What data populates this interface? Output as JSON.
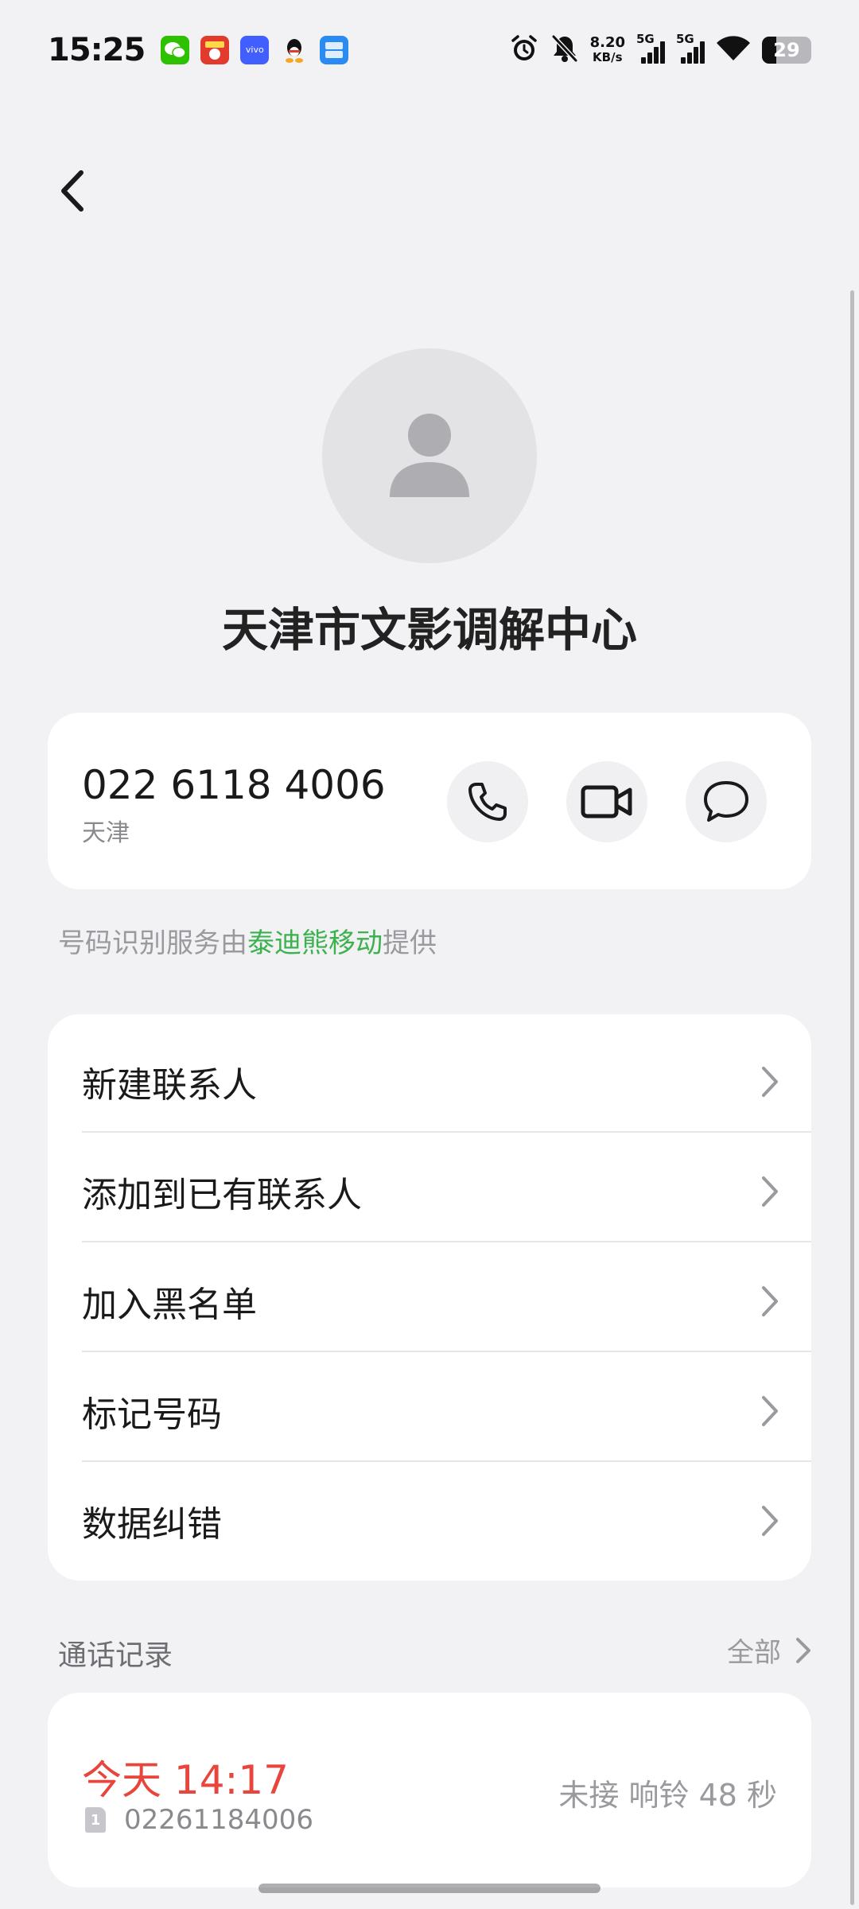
{
  "status_bar": {
    "time": "15:25",
    "apps": [
      {
        "name": "wechat-icon",
        "color": "#2dc100"
      },
      {
        "name": "shopping-app-icon",
        "color": "#e23b2e"
      },
      {
        "name": "vivo-icon",
        "color": "#415fff",
        "text": "vivo"
      },
      {
        "name": "qq-icon",
        "color": "#ffffff"
      },
      {
        "name": "xianyu-icon",
        "color": "#2a8cf3"
      }
    ],
    "net_speed_value": "8.20",
    "net_speed_unit": "KB/s",
    "network_1": "5G",
    "network_2": "5G",
    "battery": "29"
  },
  "contact": {
    "name": "天津市文影调解中心",
    "number": "022 6118 4006",
    "location": "天津"
  },
  "provider_note": {
    "prefix": "号码识别服务由",
    "provider": "泰迪熊移动",
    "suffix": "提供"
  },
  "actions": [
    {
      "label": "新建联系人"
    },
    {
      "label": "添加到已有联系人"
    },
    {
      "label": "加入黑名单"
    },
    {
      "label": "标记号码"
    },
    {
      "label": "数据纠错"
    }
  ],
  "call_log": {
    "title": "通话记录",
    "all_label": "全部",
    "entries": [
      {
        "time": "今天 14:17",
        "sim": "1",
        "number": "02261184006",
        "status": "未接 响铃 48 秒"
      }
    ]
  },
  "colors": {
    "background": "#f2f2f5",
    "card": "#ffffff",
    "provider_highlight": "#3bb24d",
    "missed_call": "#e8453c"
  }
}
